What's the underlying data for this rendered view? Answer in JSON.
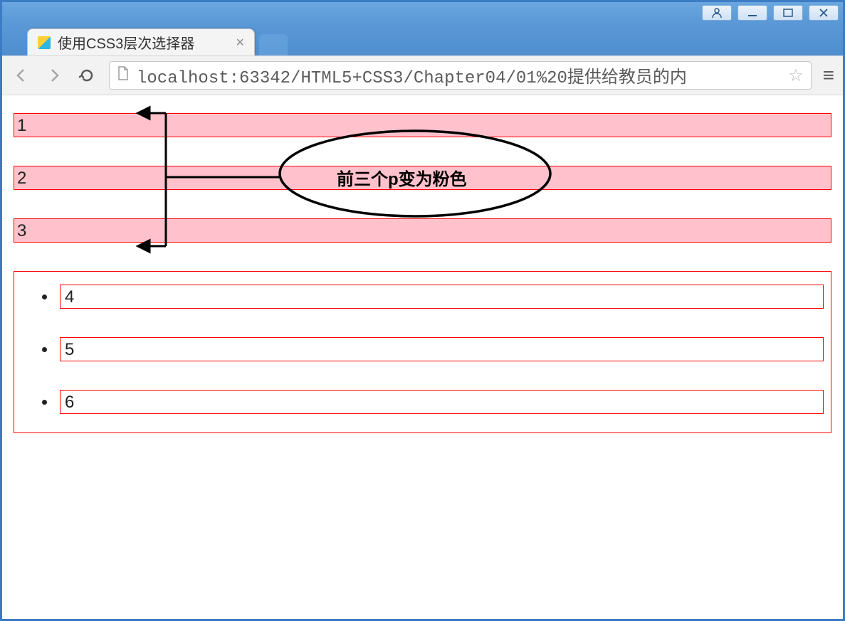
{
  "window": {
    "tab_title": "使用CSS3层次选择器",
    "url": "localhost:63342/HTML5+CSS3/Chapter04/01%20提供给教员的内"
  },
  "content": {
    "pink_rows": [
      "1",
      "2",
      "3"
    ],
    "list_items": [
      "4",
      "5",
      "6"
    ]
  },
  "annotation": {
    "label": "前三个p变为粉色"
  }
}
